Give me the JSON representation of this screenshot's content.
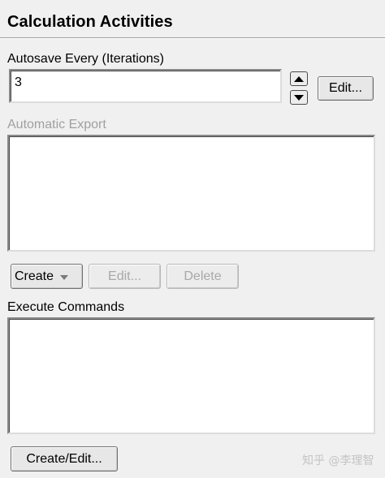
{
  "panel": {
    "title": "Calculation Activities"
  },
  "autosave": {
    "label": "Autosave Every (Iterations)",
    "value": "3",
    "edit_label": "Edit..."
  },
  "automatic_export": {
    "label": "Automatic Export",
    "create_label": "Create",
    "edit_label": "Edit...",
    "delete_label": "Delete",
    "items": []
  },
  "execute_commands": {
    "label": "Execute Commands",
    "create_edit_label": "Create/Edit...",
    "items": []
  },
  "watermark": "知乎 @李理智",
  "icons": {
    "spin_up": "arrow-up-icon",
    "spin_down": "arrow-down-icon",
    "dropdown": "chevron-down-icon"
  }
}
